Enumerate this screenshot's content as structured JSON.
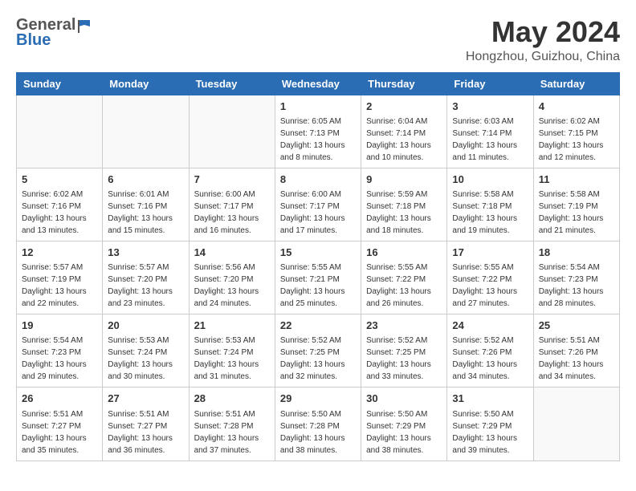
{
  "header": {
    "logo_general": "General",
    "logo_blue": "Blue",
    "month": "May 2024",
    "location": "Hongzhou, Guizhou, China"
  },
  "weekdays": [
    "Sunday",
    "Monday",
    "Tuesday",
    "Wednesday",
    "Thursday",
    "Friday",
    "Saturday"
  ],
  "weeks": [
    [
      {
        "day": "",
        "info": ""
      },
      {
        "day": "",
        "info": ""
      },
      {
        "day": "",
        "info": ""
      },
      {
        "day": "1",
        "info": "Sunrise: 6:05 AM\nSunset: 7:13 PM\nDaylight: 13 hours\nand 8 minutes."
      },
      {
        "day": "2",
        "info": "Sunrise: 6:04 AM\nSunset: 7:14 PM\nDaylight: 13 hours\nand 10 minutes."
      },
      {
        "day": "3",
        "info": "Sunrise: 6:03 AM\nSunset: 7:14 PM\nDaylight: 13 hours\nand 11 minutes."
      },
      {
        "day": "4",
        "info": "Sunrise: 6:02 AM\nSunset: 7:15 PM\nDaylight: 13 hours\nand 12 minutes."
      }
    ],
    [
      {
        "day": "5",
        "info": "Sunrise: 6:02 AM\nSunset: 7:16 PM\nDaylight: 13 hours\nand 13 minutes."
      },
      {
        "day": "6",
        "info": "Sunrise: 6:01 AM\nSunset: 7:16 PM\nDaylight: 13 hours\nand 15 minutes."
      },
      {
        "day": "7",
        "info": "Sunrise: 6:00 AM\nSunset: 7:17 PM\nDaylight: 13 hours\nand 16 minutes."
      },
      {
        "day": "8",
        "info": "Sunrise: 6:00 AM\nSunset: 7:17 PM\nDaylight: 13 hours\nand 17 minutes."
      },
      {
        "day": "9",
        "info": "Sunrise: 5:59 AM\nSunset: 7:18 PM\nDaylight: 13 hours\nand 18 minutes."
      },
      {
        "day": "10",
        "info": "Sunrise: 5:58 AM\nSunset: 7:18 PM\nDaylight: 13 hours\nand 19 minutes."
      },
      {
        "day": "11",
        "info": "Sunrise: 5:58 AM\nSunset: 7:19 PM\nDaylight: 13 hours\nand 21 minutes."
      }
    ],
    [
      {
        "day": "12",
        "info": "Sunrise: 5:57 AM\nSunset: 7:19 PM\nDaylight: 13 hours\nand 22 minutes."
      },
      {
        "day": "13",
        "info": "Sunrise: 5:57 AM\nSunset: 7:20 PM\nDaylight: 13 hours\nand 23 minutes."
      },
      {
        "day": "14",
        "info": "Sunrise: 5:56 AM\nSunset: 7:20 PM\nDaylight: 13 hours\nand 24 minutes."
      },
      {
        "day": "15",
        "info": "Sunrise: 5:55 AM\nSunset: 7:21 PM\nDaylight: 13 hours\nand 25 minutes."
      },
      {
        "day": "16",
        "info": "Sunrise: 5:55 AM\nSunset: 7:22 PM\nDaylight: 13 hours\nand 26 minutes."
      },
      {
        "day": "17",
        "info": "Sunrise: 5:55 AM\nSunset: 7:22 PM\nDaylight: 13 hours\nand 27 minutes."
      },
      {
        "day": "18",
        "info": "Sunrise: 5:54 AM\nSunset: 7:23 PM\nDaylight: 13 hours\nand 28 minutes."
      }
    ],
    [
      {
        "day": "19",
        "info": "Sunrise: 5:54 AM\nSunset: 7:23 PM\nDaylight: 13 hours\nand 29 minutes."
      },
      {
        "day": "20",
        "info": "Sunrise: 5:53 AM\nSunset: 7:24 PM\nDaylight: 13 hours\nand 30 minutes."
      },
      {
        "day": "21",
        "info": "Sunrise: 5:53 AM\nSunset: 7:24 PM\nDaylight: 13 hours\nand 31 minutes."
      },
      {
        "day": "22",
        "info": "Sunrise: 5:52 AM\nSunset: 7:25 PM\nDaylight: 13 hours\nand 32 minutes."
      },
      {
        "day": "23",
        "info": "Sunrise: 5:52 AM\nSunset: 7:25 PM\nDaylight: 13 hours\nand 33 minutes."
      },
      {
        "day": "24",
        "info": "Sunrise: 5:52 AM\nSunset: 7:26 PM\nDaylight: 13 hours\nand 34 minutes."
      },
      {
        "day": "25",
        "info": "Sunrise: 5:51 AM\nSunset: 7:26 PM\nDaylight: 13 hours\nand 34 minutes."
      }
    ],
    [
      {
        "day": "26",
        "info": "Sunrise: 5:51 AM\nSunset: 7:27 PM\nDaylight: 13 hours\nand 35 minutes."
      },
      {
        "day": "27",
        "info": "Sunrise: 5:51 AM\nSunset: 7:27 PM\nDaylight: 13 hours\nand 36 minutes."
      },
      {
        "day": "28",
        "info": "Sunrise: 5:51 AM\nSunset: 7:28 PM\nDaylight: 13 hours\nand 37 minutes."
      },
      {
        "day": "29",
        "info": "Sunrise: 5:50 AM\nSunset: 7:28 PM\nDaylight: 13 hours\nand 38 minutes."
      },
      {
        "day": "30",
        "info": "Sunrise: 5:50 AM\nSunset: 7:29 PM\nDaylight: 13 hours\nand 38 minutes."
      },
      {
        "day": "31",
        "info": "Sunrise: 5:50 AM\nSunset: 7:29 PM\nDaylight: 13 hours\nand 39 minutes."
      },
      {
        "day": "",
        "info": ""
      }
    ]
  ]
}
